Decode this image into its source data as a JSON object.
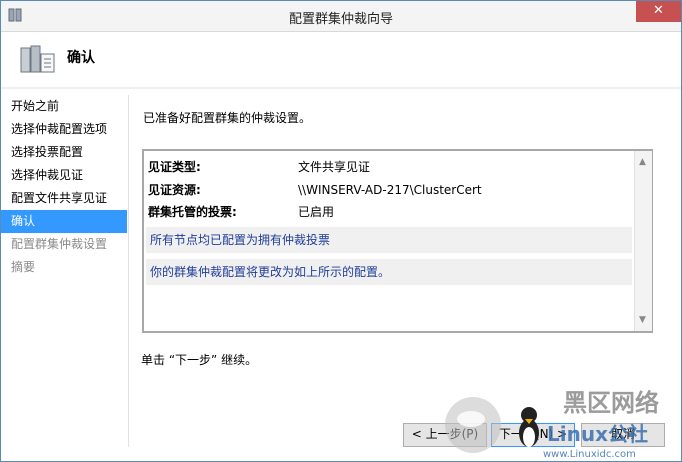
{
  "window": {
    "title": "配置群集仲裁向导",
    "close_symbol": "✕"
  },
  "header": {
    "title": "确认",
    "icon": "cluster-wizard-icon"
  },
  "nav": {
    "items": [
      {
        "label": "开始之前",
        "state": "normal"
      },
      {
        "label": "选择仲裁配置选项",
        "state": "normal"
      },
      {
        "label": "选择投票配置",
        "state": "normal"
      },
      {
        "label": "选择仲裁见证",
        "state": "normal"
      },
      {
        "label": "配置文件共享见证",
        "state": "normal"
      },
      {
        "label": "确认",
        "state": "active"
      },
      {
        "label": "配置群集仲裁设置",
        "state": "disabled"
      },
      {
        "label": "摘要",
        "state": "disabled"
      }
    ]
  },
  "main": {
    "intro": "已准备好配置群集的仲裁设置。",
    "report": {
      "rows": [
        {
          "key": "见证类型:",
          "value": "文件共享见证"
        },
        {
          "key": "见证资源:",
          "value": "\\\\WINSERV-AD-217\\ClusterCert"
        },
        {
          "key": "群集托管的投票:",
          "value": "已启用"
        }
      ],
      "notes": [
        "所有节点均已配置为拥有仲裁投票",
        "你的群集仲裁配置将更改为如上所示的配置。"
      ]
    },
    "next_hint": "单击 “下一步” 继续。"
  },
  "buttons": {
    "prev": "< 上一步(P)",
    "next": "下一步(N) >",
    "cancel": "取消"
  },
  "watermark": {
    "brand": "黑区网络",
    "site": "www.Linuxidc.com",
    "logo_text": "Linux公社"
  },
  "colors": {
    "accent": "#3399ff",
    "close": "#c75050",
    "note_text": "#1f3d99"
  }
}
